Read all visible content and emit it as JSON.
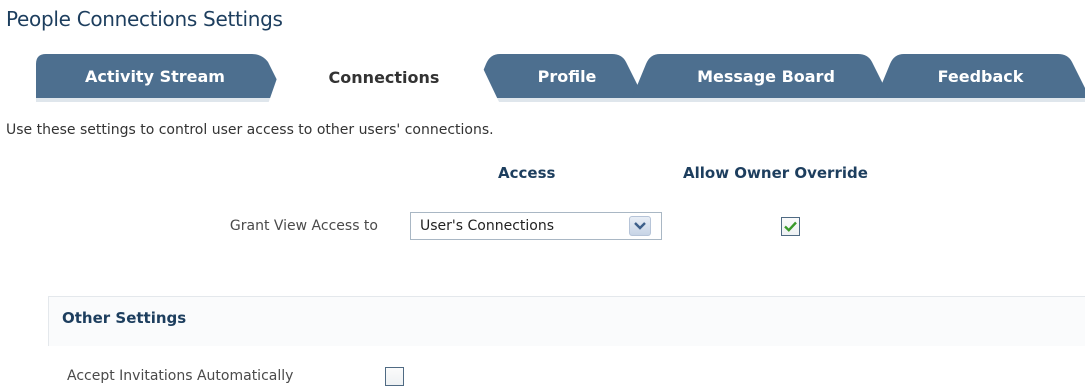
{
  "page": {
    "title": "People Connections Settings"
  },
  "tabs": [
    {
      "label": "Activity Stream",
      "selected": false
    },
    {
      "label": "Connections",
      "selected": true
    },
    {
      "label": "Profile",
      "selected": false
    },
    {
      "label": "Message Board",
      "selected": false
    },
    {
      "label": "Feedback",
      "selected": false
    }
  ],
  "connections": {
    "description": "Use these settings to control user access to other users' connections.",
    "columns": {
      "access": "Access",
      "override": "Allow Owner Override"
    },
    "grant_view_access": {
      "label": "Grant View Access to",
      "value": "User's Connections",
      "allow_owner_override": true
    }
  },
  "other_settings": {
    "title": "Other Settings",
    "accept_invitations": {
      "label": "Accept Invitations Automatically",
      "checked": false
    }
  },
  "colors": {
    "tab_inactive": "#4d6f8f",
    "tab_active": "#ffffff",
    "heading": "#1d3e5e",
    "checkmark": "#3a9a2a"
  }
}
